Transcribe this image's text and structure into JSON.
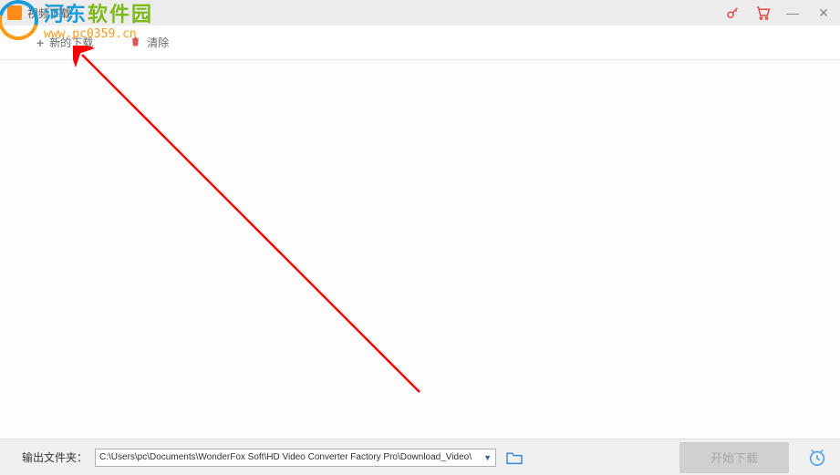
{
  "titleBar": {
    "title": "视频下载"
  },
  "toolbar": {
    "newDownload": "新的下载",
    "clear": "清除"
  },
  "bottomBar": {
    "outputLabel": "输出文件夹：",
    "outputPath": "C:\\Users\\pc\\Documents\\WonderFox Soft\\HD Video Converter Factory Pro\\Download_Video\\",
    "startButton": "开始下载"
  },
  "watermark": {
    "name1": "河东",
    "name2": "软件园",
    "url": "www.pc0359.cn"
  }
}
